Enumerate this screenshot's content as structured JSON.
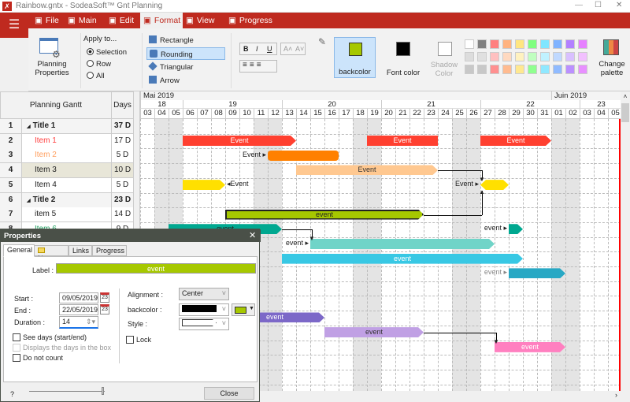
{
  "window": {
    "title": "Rainbow.gntx - SodeaSoft™ Gnt Planning",
    "minimize": "—",
    "maximize": "☐",
    "close": "✕"
  },
  "menu": {
    "hamburger": "☰",
    "tabs": [
      {
        "label": "File",
        "icon": "file-icon"
      },
      {
        "label": "Main",
        "icon": "home-icon"
      },
      {
        "label": "Edit",
        "icon": "edit-icon"
      },
      {
        "label": "Format",
        "icon": "paint-roller-icon",
        "active": true
      },
      {
        "label": "View",
        "icon": "view-icon"
      },
      {
        "label": "Progress",
        "icon": "shuffle-icon"
      }
    ]
  },
  "ribbon": {
    "planning_properties": "Planning Properties",
    "apply_to": {
      "title": "Apply to...",
      "options": [
        "Selection",
        "Row",
        "All"
      ],
      "selected": "Selection"
    },
    "shapes": [
      {
        "label": "Rectangle"
      },
      {
        "label": "Rounding",
        "selected": true
      },
      {
        "label": "Triangular"
      },
      {
        "label": "Arrow"
      }
    ],
    "font": {
      "bold": "B",
      "italic": "I",
      "underline": "U",
      "grow": "A˄",
      "shrink": "A˅"
    },
    "backcolor": {
      "label": "backcolor",
      "color": "#a6c800"
    },
    "font_color": {
      "label": "Font color",
      "color": "#000000"
    },
    "shadow_color": {
      "label": "Shadow Color",
      "color": "#ffffff"
    },
    "palette": [
      [
        "#ffffff",
        "#808080",
        "#ff8080",
        "#ffb380",
        "#ffe680",
        "#80ff80",
        "#80e6ff",
        "#80b3ff",
        "#b380ff",
        "#e680ff"
      ],
      [
        "#dddddd",
        "#e0e0e0",
        "#ffc0c0",
        "#ffd9c0",
        "#fff2c0",
        "#c0ffc0",
        "#c0f2ff",
        "#c0d9ff",
        "#d9c0ff",
        "#f2c0ff"
      ],
      [
        "#c8c8c8",
        "#c8c8c8",
        "#ff9090",
        "#ffbb90",
        "#ffe890",
        "#90ff90",
        "#90e8ff",
        "#90bbff",
        "#bb90ff",
        "#e890ff"
      ]
    ],
    "change_palette": "Change palette"
  },
  "table": {
    "header_name": "Planning Gantt",
    "header_days": "Days",
    "rows": [
      {
        "n": "1",
        "name": "Title 1",
        "days": "37 D",
        "type": "title"
      },
      {
        "n": "2",
        "name": "Item 1",
        "days": "17 D",
        "color": "#ff4040"
      },
      {
        "n": "3",
        "name": "Item 2",
        "days": "5 D",
        "color": "#ffa060"
      },
      {
        "n": "4",
        "name": "Item 3",
        "days": "10 D",
        "selected": true
      },
      {
        "n": "5",
        "name": "Item 4",
        "days": "5 D"
      },
      {
        "n": "6",
        "name": "Title 2",
        "days": "23 D",
        "type": "title"
      },
      {
        "n": "7",
        "name": "item 5",
        "days": "14 D"
      },
      {
        "n": "8",
        "name": "Item 6",
        "days": "9 D",
        "color": "#20a060"
      }
    ]
  },
  "timeline": {
    "months": [
      {
        "label": "Mai 2019",
        "start": "2019-05-03"
      },
      {
        "label": "Juin 2019",
        "start": "2019-06-01"
      }
    ],
    "weeks": [
      {
        "label": "18",
        "start": "2019-05-03"
      },
      {
        "label": "19",
        "start": "2019-05-06"
      },
      {
        "label": "20",
        "start": "2019-05-13"
      },
      {
        "label": "21",
        "start": "2019-05-20"
      },
      {
        "label": "22",
        "start": "2019-05-27"
      },
      {
        "label": "23",
        "start": "2019-06-03"
      }
    ],
    "days": [
      "03",
      "04",
      "05",
      "06",
      "07",
      "08",
      "09",
      "10",
      "11",
      "12",
      "13",
      "14",
      "15",
      "16",
      "17",
      "18",
      "19",
      "20",
      "21",
      "22",
      "23",
      "24",
      "25",
      "26",
      "27",
      "28",
      "29",
      "30",
      "31",
      "01",
      "02",
      "03",
      "04",
      "05"
    ],
    "weekends": [
      1,
      2,
      8,
      9,
      15,
      16,
      22,
      23,
      29,
      30
    ]
  },
  "bars": [
    {
      "row": 2,
      "start": "06/05",
      "end": "13/05",
      "label": "Event",
      "color": "#ff4030",
      "shape": "arrow"
    },
    {
      "row": 2,
      "start": "19/05",
      "end": "23/05",
      "label": "Event",
      "color": "#ff4030",
      "shape": "rect"
    },
    {
      "row": 2,
      "start": "27/05",
      "end": "31/05",
      "label": "Event",
      "color": "#ff4030",
      "shape": "arrow"
    },
    {
      "row": 3,
      "start": "12/05",
      "end": "16/05",
      "label": "",
      "outside": "Event",
      "color": "#ff8000",
      "shape": "round"
    },
    {
      "row": 4,
      "start": "14/05",
      "end": "23/05",
      "label": "Event",
      "color": "#ffc890",
      "shape": "arrow",
      "text": "#333"
    },
    {
      "row": 5,
      "start": "06/05",
      "end": "08/05",
      "label": "",
      "after": "Event",
      "color": "#ffe000",
      "shape": "arrow"
    },
    {
      "row": 5,
      "start": "27/05",
      "end": "28/05",
      "label": "",
      "outside": "Event",
      "color": "#ffe000",
      "shape": "hex"
    },
    {
      "row": 7,
      "start": "09/05",
      "end": "22/05",
      "label": "event",
      "color": "#a6c800",
      "shape": "arrow",
      "text": "#222",
      "border": true
    },
    {
      "row": 8,
      "start": "05/05",
      "end": "12/05",
      "label": "event",
      "color": "#00a890",
      "shape": "arrow",
      "text": "#222"
    },
    {
      "row": 8,
      "start": "29/05",
      "end": "29/05",
      "label": "",
      "outside": "event",
      "color": "#00a890",
      "shape": "arrow"
    },
    {
      "row": 9,
      "start": "15/05",
      "end": "27/05",
      "label": "",
      "outside": "event",
      "color": "#70d4c8",
      "shape": "arrow"
    },
    {
      "row": 10,
      "start": "13/05",
      "end": "29/05",
      "label": "event",
      "color": "#38c8e4",
      "shape": "arrow"
    },
    {
      "row": 11,
      "start": "29/05",
      "end": "01/06",
      "label": "",
      "outside": "event",
      "color": "#28a8c4",
      "shape": "arrow",
      "outside_color": "#888"
    },
    {
      "row": 14,
      "start": "09/05",
      "end": "15/05",
      "label": "event",
      "color": "#7c68c8",
      "shape": "arrow"
    },
    {
      "row": 15,
      "start": "16/05",
      "end": "22/05",
      "label": "event",
      "color": "#c0a0e4",
      "shape": "arrow",
      "text": "#333"
    },
    {
      "row": 16,
      "start": "28/05",
      "end": "01/06",
      "label": "event",
      "color": "#ff80c0",
      "shape": "arrow"
    }
  ],
  "links": [
    {
      "from": 4,
      "to": 5,
      "from_end": "23/05",
      "to_day": "27/05"
    },
    {
      "from": 7,
      "to": 5,
      "from_end": "22/05",
      "to_day": "27/05"
    },
    {
      "from": 8,
      "to": 9,
      "from_end": "12/05",
      "to_day": "15/05"
    },
    {
      "from": 15,
      "to": 16,
      "from_end": "22/05",
      "to_day": "28/05"
    }
  ],
  "dialog": {
    "title": "Properties",
    "close": "✕",
    "tabs": [
      "General",
      "Notes",
      "Links",
      "Progress"
    ],
    "label_caption": "Label :",
    "label_value": "event",
    "label_color": "#a6c800",
    "start_caption": "Start :",
    "start": "09/05/2019",
    "end_caption": "End :",
    "end": "22/05/2019",
    "duration_caption": "Duration :",
    "duration": "14",
    "calendar_icon_text": "23",
    "see_days": "See days (start/end)",
    "displays_days": "Displays the days in the box",
    "do_not_count": "Do not count",
    "alignment_caption": "Alignment :",
    "alignment": "Center",
    "backcolor_caption": "backcolor :",
    "backcolor_value": "#000000",
    "backcolor_swatch": "#a6c800",
    "style_caption": "Style :",
    "lock": "Lock",
    "help": "?",
    "close_button": "Close"
  }
}
